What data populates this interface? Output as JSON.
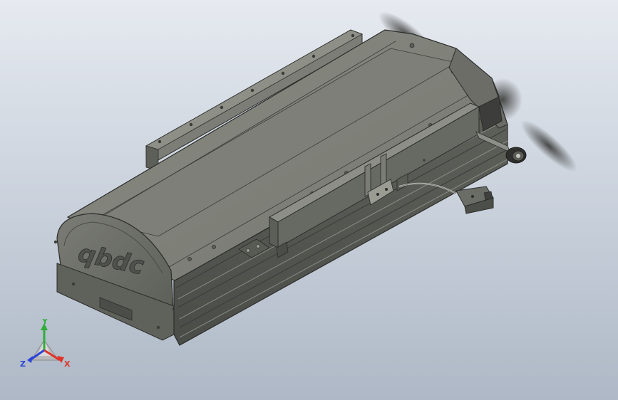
{
  "viewport": {
    "background_top": "#e6eaf0",
    "background_bottom": "#aeb8c6"
  },
  "model": {
    "logo_text": "qbdc",
    "colors": {
      "body": "#6e706a",
      "body_light": "#868880",
      "body_dark": "#4e504b",
      "edge": "#2c2d2a",
      "motor": "#3c3e3a"
    }
  },
  "triad": {
    "x_label": "X",
    "y_label": "Y",
    "z_label": "Z",
    "x_color": "#e0342a",
    "y_color": "#2fae3a",
    "z_color": "#2d45d6"
  }
}
